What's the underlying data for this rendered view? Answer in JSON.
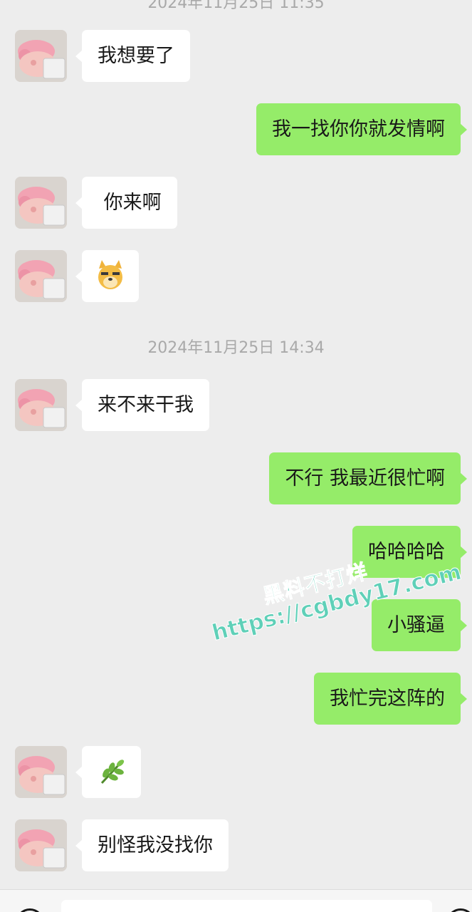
{
  "chat": {
    "timestamps": {
      "top_partial": "2024年11月25日 11:35",
      "middle": "2024年11月25日 14:34"
    },
    "messages": [
      {
        "side": "left",
        "text": "我想要了"
      },
      {
        "side": "right",
        "text": "我一找你你就发情啊"
      },
      {
        "side": "left",
        "text": " 你来啊"
      },
      {
        "side": "left",
        "emoji": "doge-emoji",
        "text": ""
      },
      {
        "side": "left",
        "text": "来不来干我"
      },
      {
        "side": "right",
        "text": "不行 我最近很忙啊"
      },
      {
        "side": "right",
        "text": "哈哈哈哈"
      },
      {
        "side": "right",
        "text": "小骚逼"
      },
      {
        "side": "right",
        "text": "我忙完这阵的"
      },
      {
        "side": "left",
        "emoji": "herb-emoji",
        "text": ""
      },
      {
        "side": "left",
        "text": "别怪我没找你"
      }
    ]
  },
  "watermark": {
    "line1": "黑料不打烊",
    "line2": "https://cgbdy17.com"
  },
  "colors": {
    "background": "#ededed",
    "bubble_self": "#95ec69",
    "bubble_other": "#ffffff",
    "timestamp": "#a9a9a9",
    "watermark": "#5fd0b8"
  }
}
